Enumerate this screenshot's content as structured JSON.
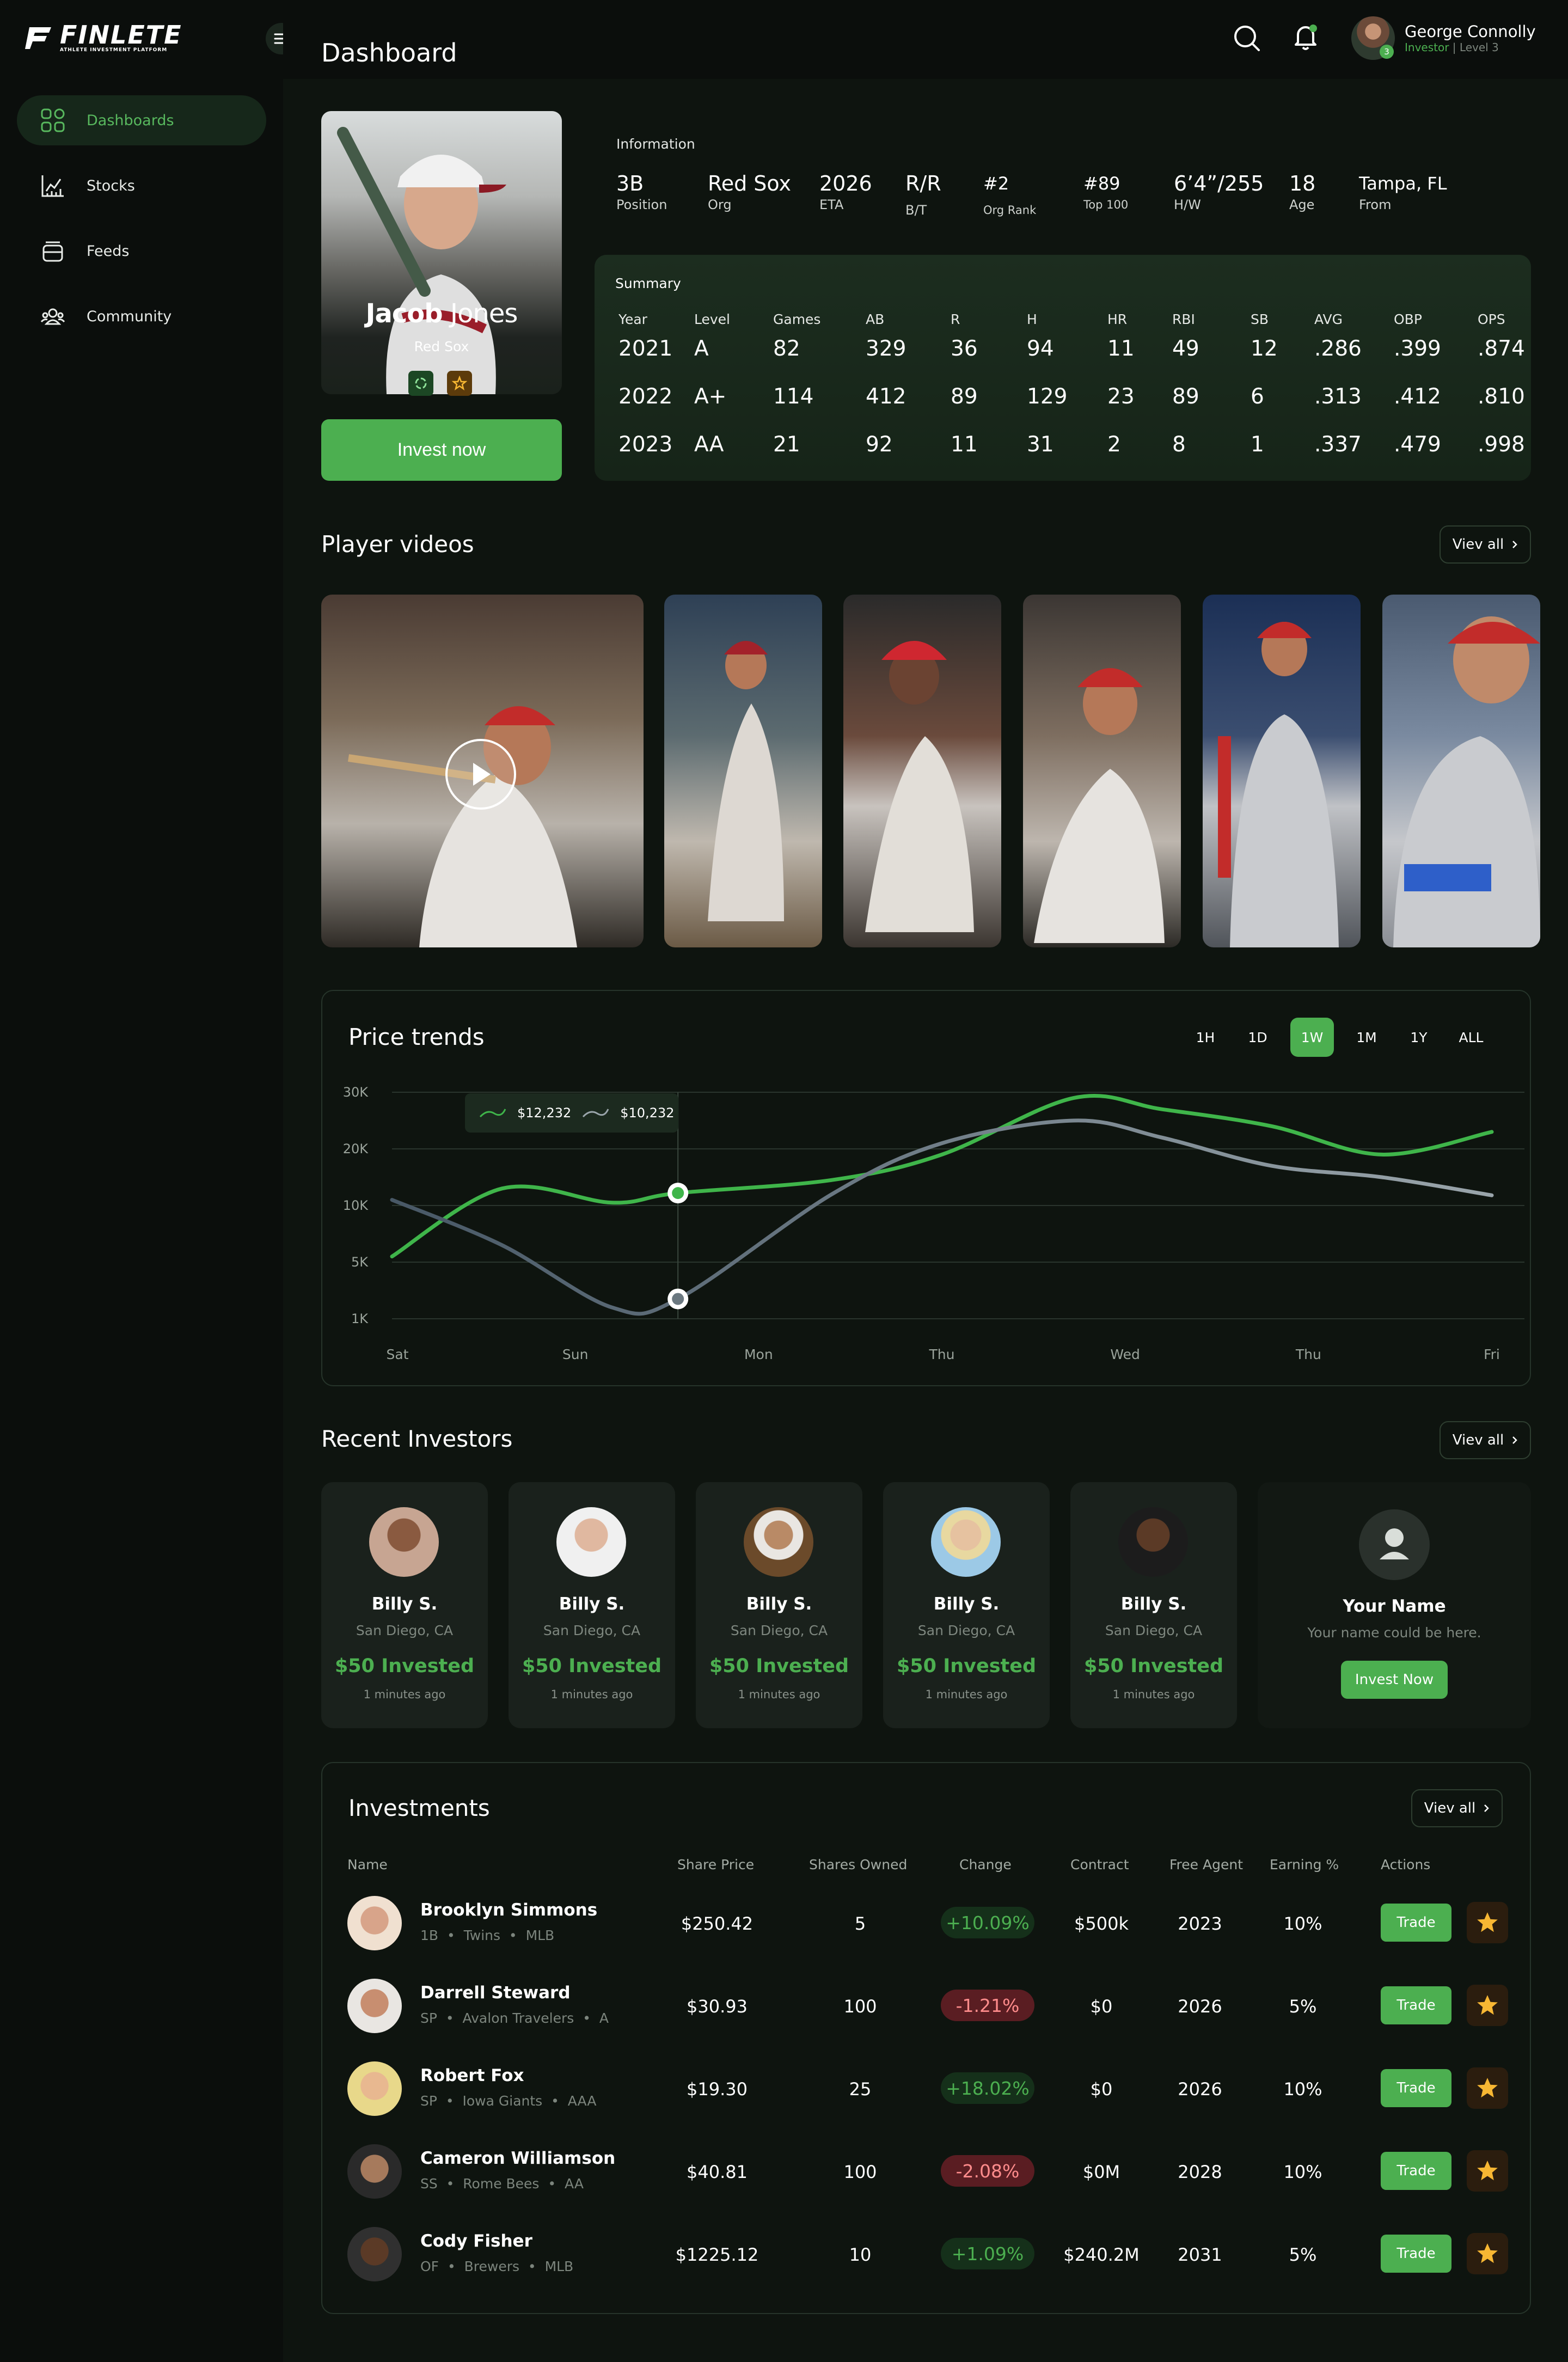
{
  "brand": {
    "name": "FINLETE",
    "tagline": "ATHLETE INVESTMENT PLATFORM"
  },
  "nav": [
    {
      "label": "Dashboards",
      "icon": "dashboard-grid-icon",
      "active": true
    },
    {
      "label": "Stocks",
      "icon": "stocks-chart-icon",
      "active": false
    },
    {
      "label": "Feeds",
      "icon": "feeds-icon",
      "active": false
    },
    {
      "label": "Community",
      "icon": "community-icon",
      "active": false
    }
  ],
  "header": {
    "title": "Dashboard"
  },
  "user": {
    "name": "George Connolly",
    "role": "Investor",
    "level": "Level 3",
    "badge_count": "3"
  },
  "player": {
    "first_name": "Jacob",
    "last_name": "Jones",
    "org": "Red Sox",
    "cta": "Invest now",
    "information_label": "Information",
    "info": [
      {
        "value": "3B",
        "label": "Position"
      },
      {
        "value": "Red Sox",
        "label": "Org"
      },
      {
        "value": "2026",
        "label": "ETA"
      },
      {
        "value": "R/R",
        "label": "B/T"
      },
      {
        "value": "#2",
        "label": "Org Rank"
      },
      {
        "value": "#89",
        "label": "Top 100"
      },
      {
        "value": "6’4”/255",
        "label": "H/W"
      },
      {
        "value": "18",
        "label": "Age"
      },
      {
        "value": "Tampa, FL",
        "label": "From"
      }
    ]
  },
  "summary": {
    "title": "Summary",
    "headers": [
      "Year",
      "Level",
      "Games",
      "AB",
      "R",
      "H",
      "HR",
      "RBI",
      "SB",
      "AVG",
      "OBP",
      "OPS"
    ],
    "rows": [
      [
        "2021",
        "A",
        "82",
        "329",
        "36",
        "94",
        "11",
        "49",
        "12",
        ".286",
        ".399",
        ".874"
      ],
      [
        "2022",
        "A+",
        "114",
        "412",
        "89",
        "129",
        "23",
        "89",
        "6",
        ".313",
        ".412",
        ".810"
      ],
      [
        "2023",
        "AA",
        "21",
        "92",
        "11",
        "31",
        "2",
        "8",
        "1",
        ".337",
        ".479",
        ".998"
      ]
    ]
  },
  "videos": {
    "title": "Player videos",
    "view_all": "Viev all"
  },
  "price_trends": {
    "title": "Price trends",
    "ranges": [
      "1H",
      "1D",
      "1W",
      "1M",
      "1Y",
      "ALL"
    ],
    "active_range": "1W",
    "tooltip": {
      "series_a": "$12,232",
      "series_b": "$10,232"
    }
  },
  "chart_data": {
    "type": "line",
    "title": "Price trends",
    "x": [
      "Sat",
      "Sun",
      "Mon",
      "Thu",
      "Wed",
      "Thu",
      "Fri"
    ],
    "y_ticks": [
      "30K",
      "20K",
      "10K",
      "5K",
      "1K"
    ],
    "y_tick_values": [
      30000,
      20000,
      10000,
      5000,
      1000
    ],
    "series": [
      {
        "color": "#3fb54a",
        "values": [
          5500,
          13000,
          10500,
          12200,
          14500,
          19000,
          29000,
          27000,
          24000,
          19000,
          23000
        ]
      },
      {
        "color": "#9aa5ab",
        "values": [
          11000,
          6500,
          1800,
          2400,
          12000,
          21000,
          25000,
          22000,
          17000,
          15000,
          11800
        ]
      }
    ],
    "x_positions": [
      0,
      0.1,
      0.2,
      0.26,
      0.4,
      0.5,
      0.62,
      0.7,
      0.8,
      0.9,
      1.0
    ],
    "marker_index": 3,
    "grid": true
  },
  "recent_investors": {
    "title": "Recent Investors",
    "view_all": "Viev all",
    "items": [
      {
        "name": "Billy S.",
        "location": "San Diego, CA",
        "amount": "$50 Invested",
        "time": "1 minutes ago"
      },
      {
        "name": "Billy S.",
        "location": "San Diego, CA",
        "amount": "$50 Invested",
        "time": "1 minutes ago"
      },
      {
        "name": "Billy S.",
        "location": "San Diego, CA",
        "amount": "$50 Invested",
        "time": "1 minutes ago"
      },
      {
        "name": "Billy S.",
        "location": "San Diego, CA",
        "amount": "$50 Invested",
        "time": "1 minutes ago"
      },
      {
        "name": "Billy S.",
        "location": "San Diego, CA",
        "amount": "$50 Invested",
        "time": "1 minutes ago"
      }
    ],
    "placeholder": {
      "name": "Your Name",
      "note": "Your name could be here.",
      "cta": "Invest Now"
    }
  },
  "investments": {
    "title": "Investments",
    "view_all": "Viev all",
    "headers": [
      "Name",
      "Share Price",
      "Shares Owned",
      "Change",
      "Contract",
      "Free Agent",
      "Earning %",
      "Actions"
    ],
    "trade_label": "Trade",
    "rows": [
      {
        "name": "Brooklyn Simmons",
        "pos": "1B",
        "team": "Twins",
        "league": "MLB",
        "price": "$250.42",
        "shares": "5",
        "change": "+10.09%",
        "dir": "up",
        "contract": "$500k",
        "free_agent": "2023",
        "earning": "10%"
      },
      {
        "name": "Darrell Steward",
        "pos": "SP",
        "team": "Avalon Travelers",
        "league": "A",
        "price": "$30.93",
        "shares": "100",
        "change": "-1.21%",
        "dir": "down",
        "contract": "$0",
        "free_agent": "2026",
        "earning": "5%"
      },
      {
        "name": "Robert Fox",
        "pos": "SP",
        "team": "Iowa Giants",
        "league": "AAA",
        "price": "$19.30",
        "shares": "25",
        "change": "+18.02%",
        "dir": "up",
        "contract": "$0",
        "free_agent": "2026",
        "earning": "10%"
      },
      {
        "name": "Cameron Williamson",
        "pos": "SS",
        "team": "Rome Bees",
        "league": "AA",
        "price": "$40.81",
        "shares": "100",
        "change": "-2.08%",
        "dir": "down",
        "contract": "$0M",
        "free_agent": "2028",
        "earning": "10%"
      },
      {
        "name": "Cody Fisher",
        "pos": "OF",
        "team": "Brewers",
        "league": "MLB",
        "price": "$1225.12",
        "shares": "10",
        "change": "+1.09%",
        "dir": "up",
        "contract": "$240.2M",
        "free_agent": "2031",
        "earning": "5%"
      }
    ]
  }
}
